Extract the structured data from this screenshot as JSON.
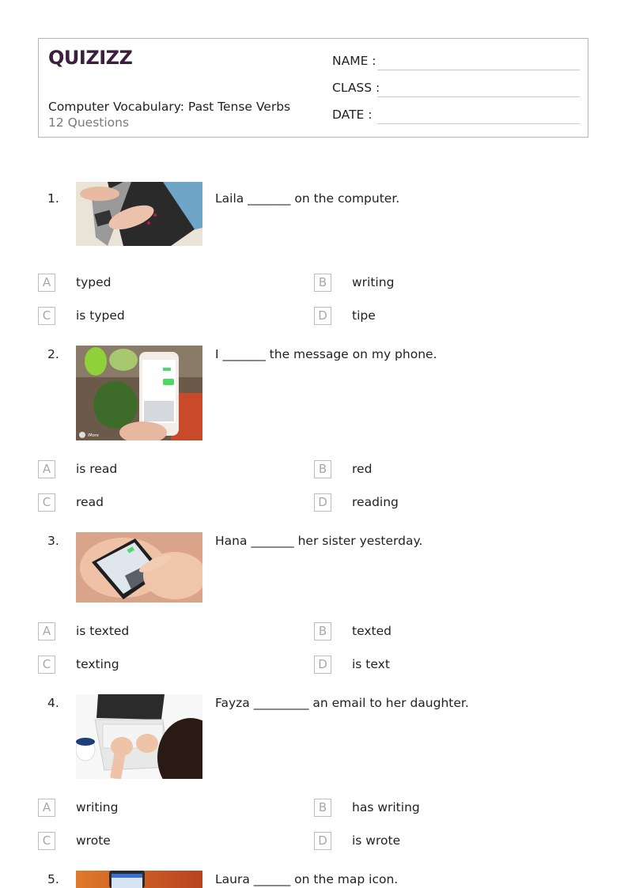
{
  "header": {
    "logo": "QUIZIZZ",
    "logo_color": "#3b1f3d",
    "title": "Computer Vocabulary: Past Tense Verbs",
    "question_count": "12 Questions",
    "fields": [
      {
        "label": "NAME :"
      },
      {
        "label": "CLASS :"
      },
      {
        "label": "DATE  :"
      }
    ]
  },
  "questions": [
    {
      "number": "1.",
      "text": "Laila _______ on the computer.",
      "image": "hands-typing-on-laptop-photo",
      "options": [
        {
          "letter": "A",
          "text": "typed"
        },
        {
          "letter": "B",
          "text": "writing"
        },
        {
          "letter": "C",
          "text": "is typed"
        },
        {
          "letter": "D",
          "text": "tipe"
        }
      ]
    },
    {
      "number": "2.",
      "text": "I _______ the message on my phone.",
      "image": "hand-holding-smartphone-messages-photo",
      "image_caption": "iMore",
      "options": [
        {
          "letter": "A",
          "text": "is read"
        },
        {
          "letter": "B",
          "text": "red"
        },
        {
          "letter": "C",
          "text": "read"
        },
        {
          "letter": "D",
          "text": "reading"
        }
      ]
    },
    {
      "number": "3.",
      "text": "Hana _______ her sister yesterday.",
      "image": "hands-texting-on-phone-photo",
      "options": [
        {
          "letter": "A",
          "text": "is texted"
        },
        {
          "letter": "B",
          "text": "texted"
        },
        {
          "letter": "C",
          "text": "texting"
        },
        {
          "letter": "D",
          "text": "is text"
        }
      ]
    },
    {
      "number": "4.",
      "text": "Fayza _________ an email to her daughter.",
      "image": "woman-typing-on-white-laptop-photo",
      "options": [
        {
          "letter": "A",
          "text": "writing"
        },
        {
          "letter": "B",
          "text": "has writing"
        },
        {
          "letter": "C",
          "text": "wrote"
        },
        {
          "letter": "D",
          "text": "is wrote"
        }
      ]
    },
    {
      "number": "5.",
      "text": "Laura ______ on the map icon.",
      "image": "phone-map-app-photo"
    }
  ]
}
